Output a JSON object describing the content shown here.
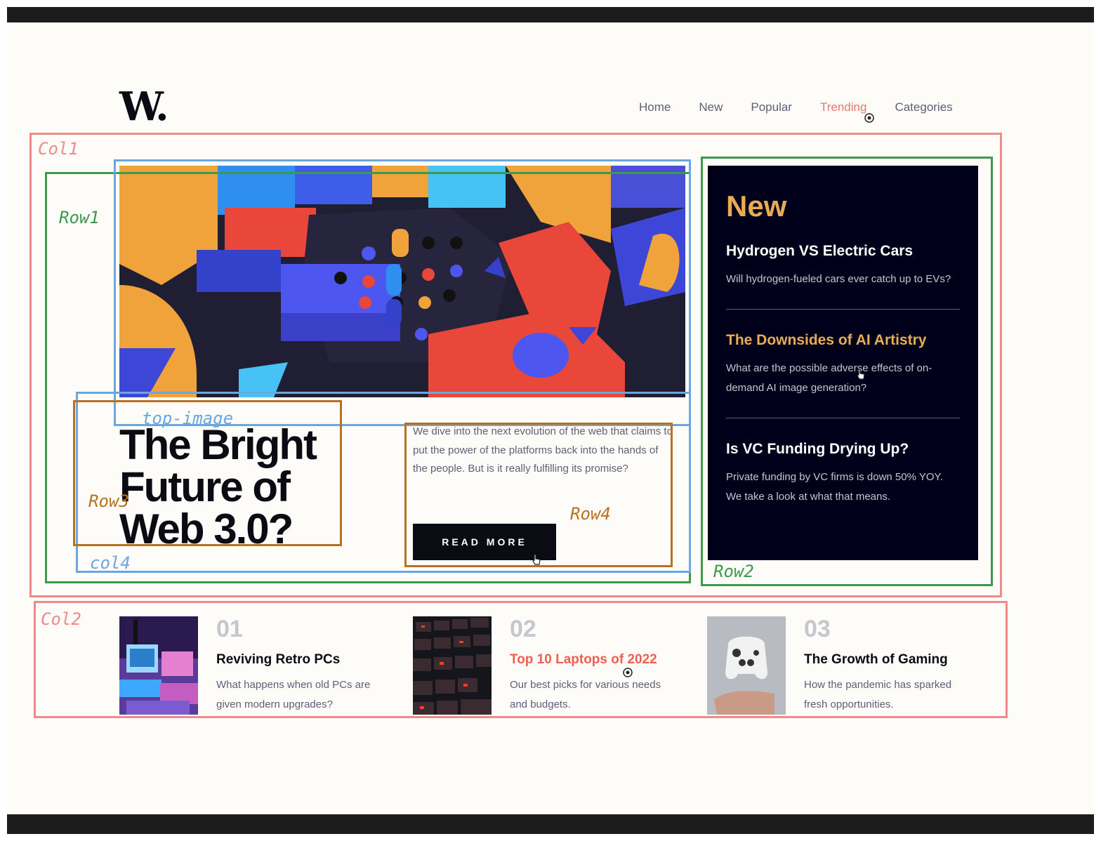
{
  "logo": "W.",
  "nav": {
    "items": [
      "Home",
      "New",
      "Popular",
      "Trending",
      "Categories"
    ],
    "active": "Trending"
  },
  "hero": {
    "title_lines": [
      "The Bright",
      "Future of",
      "Web 3.0?"
    ],
    "teaser": "We dive into the next evolution of the web that claims to put the power of the platforms back into the hands of the people. But is it really fulfilling its promise?",
    "button": "READ MORE"
  },
  "new_panel": {
    "title": "New",
    "items": [
      {
        "title": "Hydrogen VS Electric Cars",
        "desc": "Will hydrogen-fueled cars ever catch up to EVs?"
      },
      {
        "title": "The Downsides of AI Artistry",
        "desc": "What are the possible adverse effects of on-demand AI image generation?"
      },
      {
        "title": "Is VC Funding Drying Up?",
        "desc": "Private funding by VC firms is down 50% YOY. We take a look at what that means."
      }
    ]
  },
  "cards": [
    {
      "num": "01",
      "title": "Reviving Retro PCs",
      "desc": "What happens when old PCs are given modern upgrades?"
    },
    {
      "num": "02",
      "title": "Top 10 Laptops of 2022",
      "desc": "Our best picks for various needs and budgets."
    },
    {
      "num": "03",
      "title": "The Growth of Gaming",
      "desc": "How the pandemic has sparked fresh opportunities."
    }
  ],
  "annotations": {
    "col1": "Col1",
    "col2": "Col2",
    "row1": "Row1",
    "row2": "Row2",
    "row3": "Row3",
    "row4": "Row4",
    "col4": "col4",
    "top_image": "top-image"
  },
  "colors": {
    "accent_orange": "#e9ab53",
    "accent_red": "#f15e50",
    "dark": "#00001a",
    "text_grey": "#5d5f79"
  }
}
